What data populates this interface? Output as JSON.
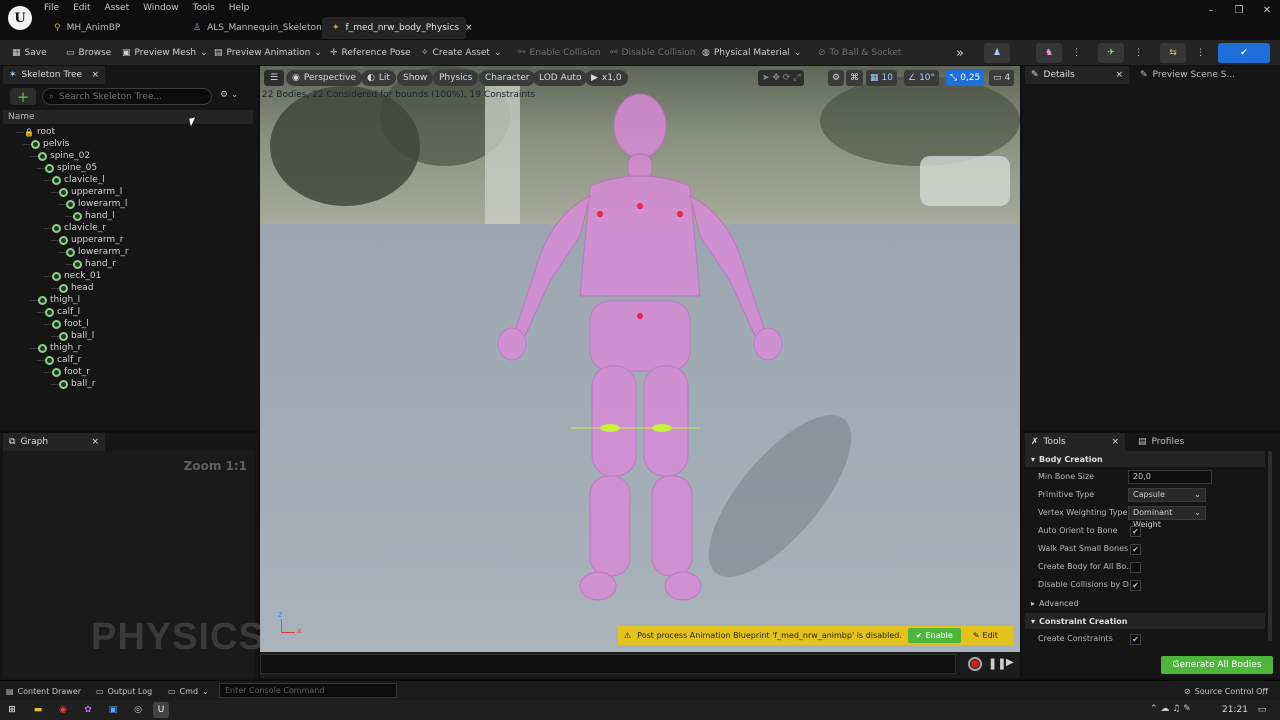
{
  "app": {
    "logo_glyph": "U",
    "menu": [
      "File",
      "Edit",
      "Asset",
      "Window",
      "Tools",
      "Help"
    ],
    "window_controls": [
      "–",
      "❐",
      "✕"
    ]
  },
  "doc_tabs": [
    {
      "label": "MH_AnimBP",
      "icon": "anim-blueprint-icon",
      "active": false
    },
    {
      "label": "ALS_Mannequin_Skeleton",
      "icon": "skeleton-icon",
      "active": false
    },
    {
      "label": "f_med_nrw_body_Physics",
      "icon": "physics-asset-icon",
      "active": true,
      "close": "×"
    }
  ],
  "toolbar": {
    "save": "Save",
    "browse": "Browse",
    "preview_mesh": "Preview Mesh",
    "preview_animation": "Preview Animation",
    "reference_pose": "Reference Pose",
    "create_asset": "Create Asset",
    "enable_collision": "Enable Collision",
    "disable_collision": "Disable Collision",
    "physical_material": "Physical Material",
    "to_ball_socket": "To Ball & Socket"
  },
  "skeleton_tree": {
    "tab_label": "Skeleton Tree",
    "search_placeholder": "Search Skeleton Tree...",
    "column_name": "Name",
    "bones": [
      {
        "name": "root",
        "depth": 0,
        "icon": "lock"
      },
      {
        "name": "pelvis",
        "depth": 1
      },
      {
        "name": "spine_02",
        "depth": 2
      },
      {
        "name": "spine_05",
        "depth": 3
      },
      {
        "name": "clavicle_l",
        "depth": 4
      },
      {
        "name": "upperarm_l",
        "depth": 5
      },
      {
        "name": "lowerarm_l",
        "depth": 6
      },
      {
        "name": "hand_l",
        "depth": 7
      },
      {
        "name": "clavicle_r",
        "depth": 4
      },
      {
        "name": "upperarm_r",
        "depth": 5
      },
      {
        "name": "lowerarm_r",
        "depth": 6
      },
      {
        "name": "hand_r",
        "depth": 7
      },
      {
        "name": "neck_01",
        "depth": 4
      },
      {
        "name": "head",
        "depth": 5
      },
      {
        "name": "thigh_l",
        "depth": 2
      },
      {
        "name": "calf_l",
        "depth": 3
      },
      {
        "name": "foot_l",
        "depth": 4
      },
      {
        "name": "ball_l",
        "depth": 5
      },
      {
        "name": "thigh_r",
        "depth": 2
      },
      {
        "name": "calf_r",
        "depth": 3
      },
      {
        "name": "foot_r",
        "depth": 4
      },
      {
        "name": "ball_r",
        "depth": 5
      }
    ]
  },
  "graph": {
    "tab_label": "Graph",
    "zoom": "Zoom 1:1",
    "watermark": "PHYSICS"
  },
  "viewport": {
    "perspective": "Perspective",
    "lit": "Lit",
    "show": "Show",
    "physics": "Physics",
    "character": "Character",
    "lod": "LOD Auto",
    "play_speed": "x1,0",
    "stats": "22 Bodies, 22 Considered for bounds (100%), 19 Constraints",
    "grid_snap": "10",
    "rot_snap": "10°",
    "scale_snap": "0,25",
    "camera_speed": "4",
    "notification": "Post process Animation Blueprint 'f_med_nrw_animbp' is disabled.",
    "enable_label": "Enable",
    "edit_label": "Edit",
    "axis_z": "z",
    "axis_x": "x"
  },
  "details": {
    "tab_label": "Details",
    "preview_tab": "Preview Scene S..."
  },
  "tools": {
    "tab_label": "Tools",
    "profiles_tab": "Profiles",
    "body_creation": "Body Creation",
    "min_bone_size_label": "Min Bone Size",
    "min_bone_size": "20,0",
    "primitive_type_label": "Primitive Type",
    "primitive_type": "Capsule",
    "vertex_weighting_label": "Vertex Weighting Type",
    "vertex_weighting": "Dominant Weight",
    "auto_orient_label": "Auto Orient to Bone",
    "walk_past_label": "Walk Past Small Bones",
    "create_body_all_label": "Create Body for All Bo...",
    "disable_collisions_label": "Disable Collisions by D...",
    "advanced": "Advanced",
    "constraint_creation": "Constraint Creation",
    "create_constraints_label": "Create Constraints",
    "generate_button": "Generate All Bodies",
    "check_states": {
      "auto_orient": true,
      "walk_past": true,
      "create_body_all": false,
      "disable_collisions": true,
      "create_constraints": true
    }
  },
  "statusbar": {
    "content_drawer": "Content Drawer",
    "output_log": "Output Log",
    "cmd": "Cmd",
    "console_placeholder": "Enter Console Command",
    "source_control": "Source Control Off"
  },
  "taskbar": {
    "time": "21:21"
  },
  "colors": {
    "accent_green": "#4fb63c",
    "accent_blue": "#1e6fd9",
    "warning_yellow": "#e4c21d",
    "body_pink": "#d88ad8"
  }
}
